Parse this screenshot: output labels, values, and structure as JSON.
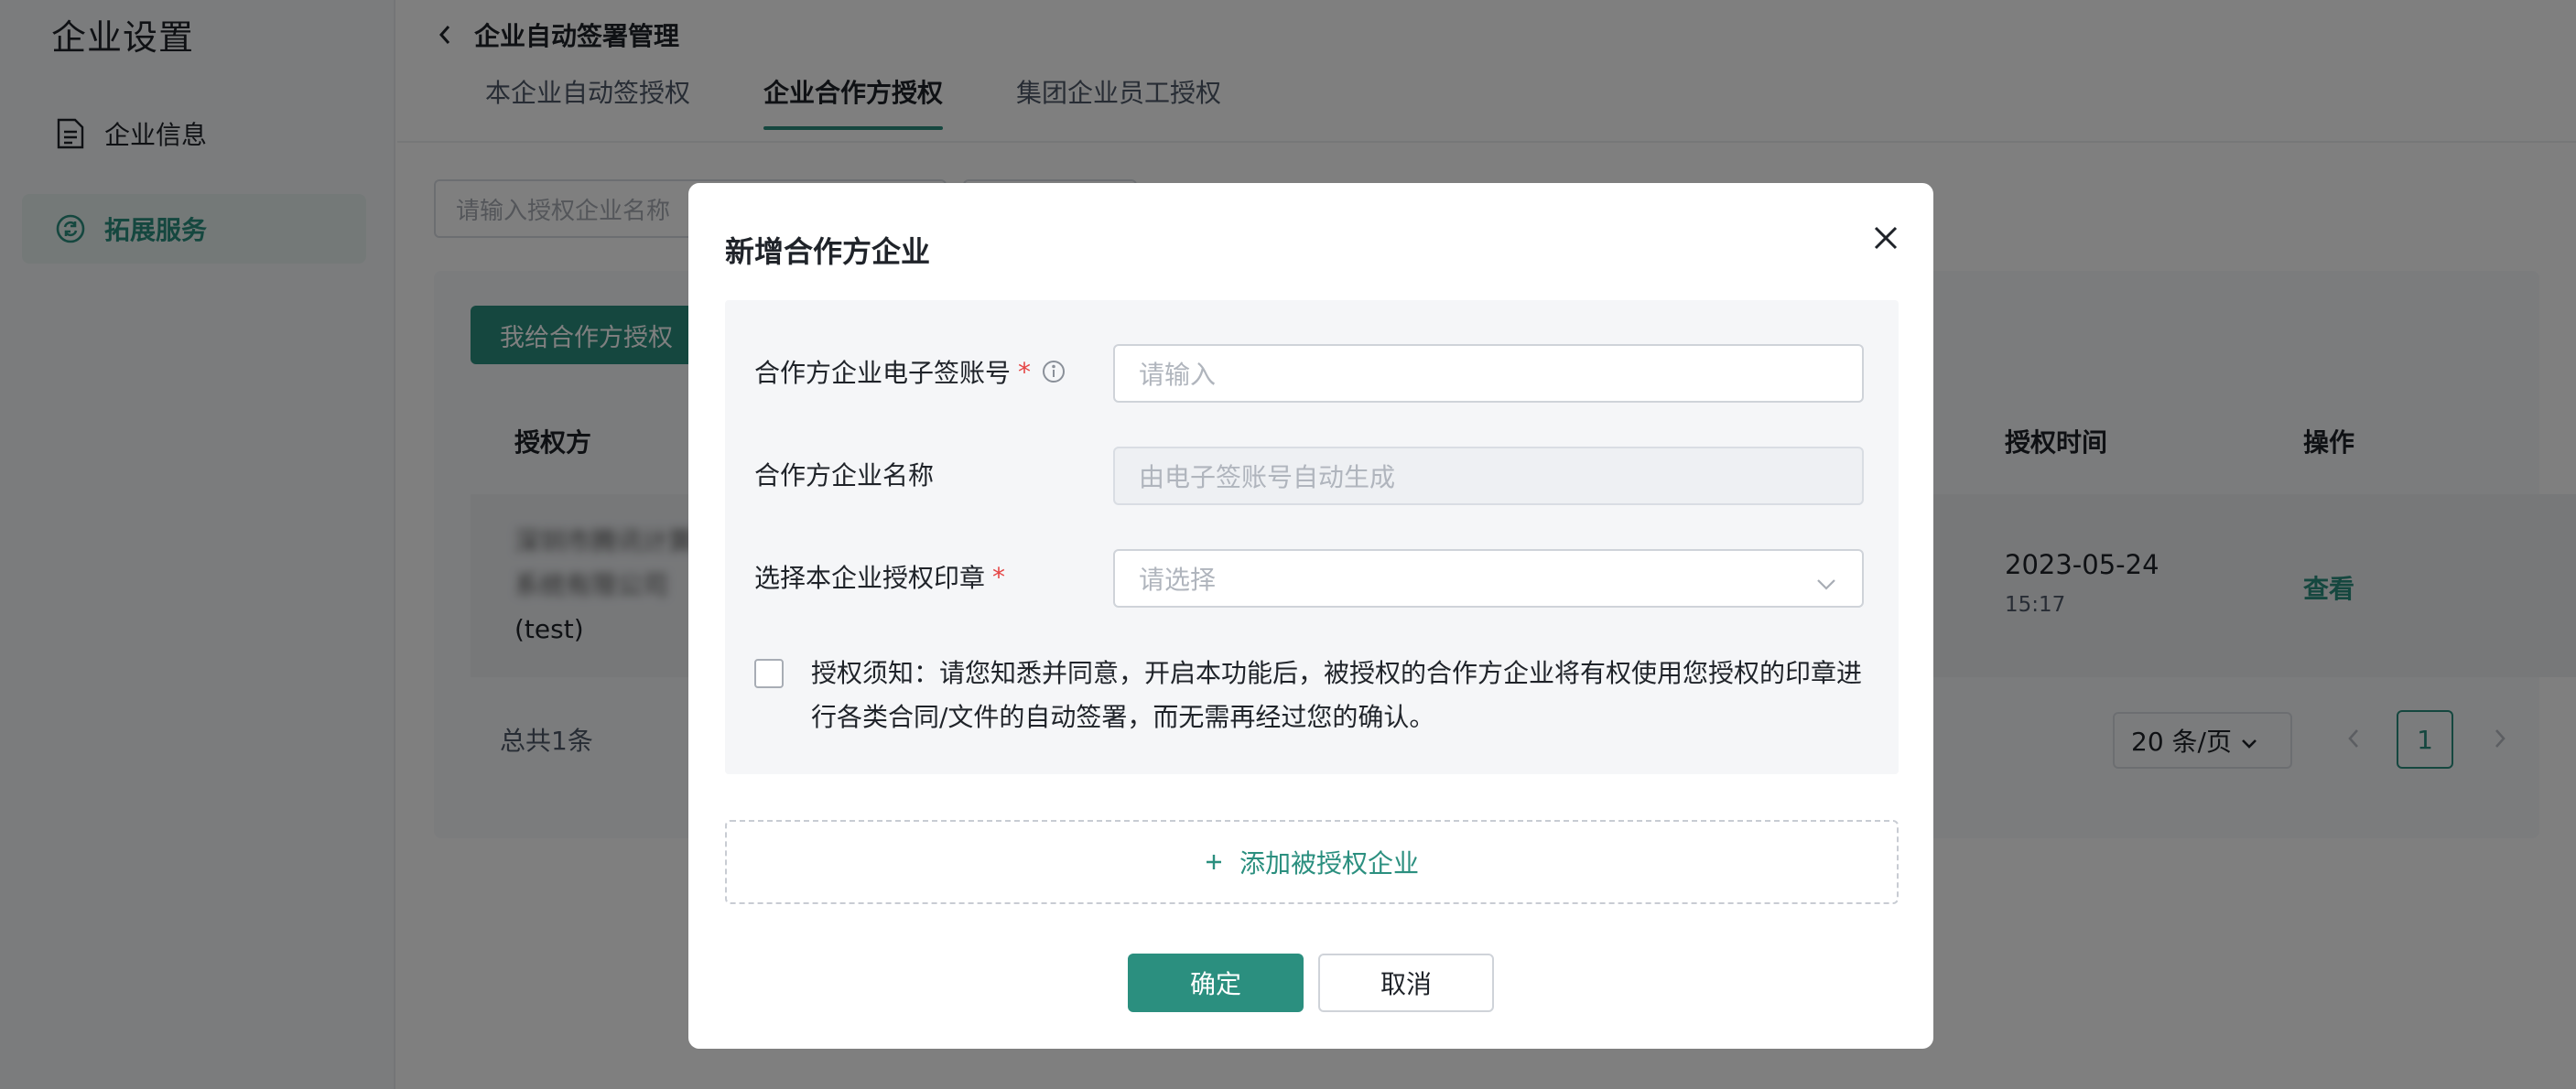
{
  "sidebar": {
    "title": "企业设置",
    "items": [
      {
        "label": "企业信息",
        "icon": "document-icon",
        "active": false
      },
      {
        "label": "拓展服务",
        "icon": "refresh-circle-icon",
        "active": true
      }
    ]
  },
  "header": {
    "back_title": "企业自动签署管理",
    "tabs": [
      {
        "label": "本企业自动签授权",
        "active": false
      },
      {
        "label": "企业合作方授权",
        "active": true
      },
      {
        "label": "集团企业员工授权",
        "active": false
      }
    ]
  },
  "toolbar": {
    "search_placeholder": "请输入授权企业名称",
    "grant_button": "我给合作方授权"
  },
  "table": {
    "headers": {
      "grantor": "授权方",
      "grant_time": "授权时间",
      "action": "操作"
    },
    "rows": [
      {
        "grantor_line1": "深圳市腾讯计算机",
        "grantor_line2": "系统有限公司",
        "grantor_line3": "(test)",
        "date": "2023-05-24",
        "time": "15:17",
        "action": "查看"
      }
    ]
  },
  "pagination": {
    "total": "总共1条",
    "page_size": "20 条/页",
    "current_page": "1"
  },
  "modal": {
    "title": "新增合作方企业",
    "fields": {
      "account_label": "合作方企业电子签账号",
      "account_placeholder": "请输入",
      "name_label": "合作方企业名称",
      "name_placeholder": "由电子签账号自动生成",
      "seal_label": "选择本企业授权印章",
      "seal_placeholder": "请选择",
      "required_mark": "*"
    },
    "notice": "授权须知：请您知悉并同意，开启本功能后，被授权的合作方企业将有权使用您授权的印章进行各类合同/文件的自动签署，而无需再经过您的确认。",
    "add_label": "添加被授权企业",
    "ok_label": "确定",
    "cancel_label": "取消"
  },
  "colors": {
    "accent": "#2b8f7f",
    "required": "#e54545"
  }
}
